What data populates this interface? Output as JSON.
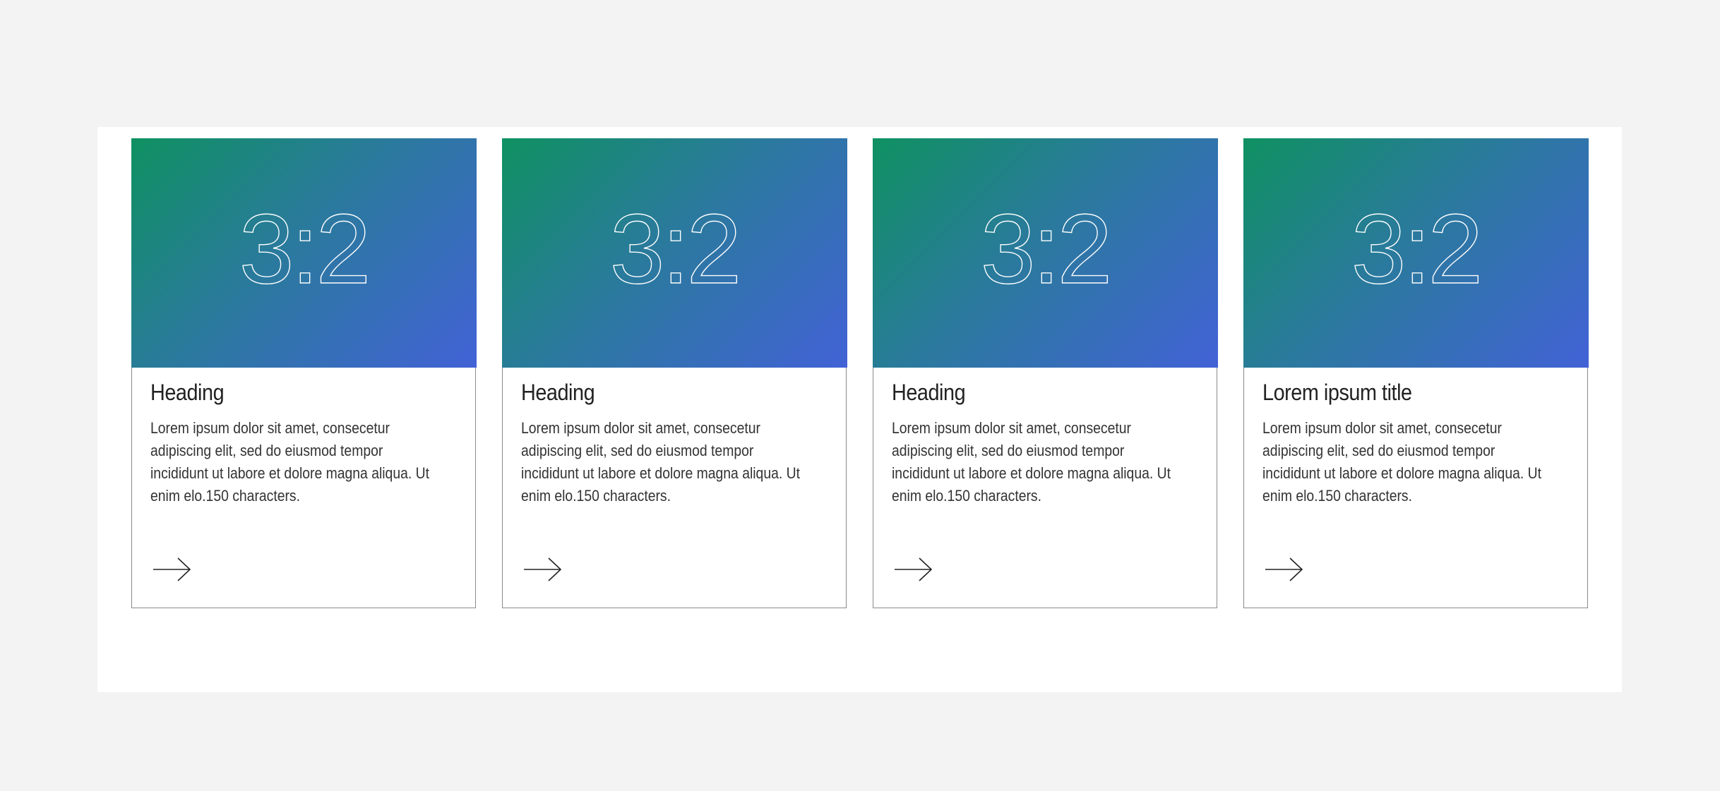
{
  "colors": {
    "gradient_start": "#0f9161",
    "gradient_end": "#4262d6"
  },
  "cards": [
    {
      "ratio_label": "3:2",
      "heading": "Heading",
      "body": "Lorem ipsum dolor sit amet, consecetur adipiscing elit, sed do eiusmod tempor incididunt ut labore et dolore magna aliqua. Ut enim elo.150 characters.",
      "icon": "arrow-right-icon"
    },
    {
      "ratio_label": "3:2",
      "heading": "Heading",
      "body": "Lorem ipsum dolor sit amet, consecetur adipiscing elit, sed do eiusmod tempor incididunt ut labore et dolore magna aliqua. Ut enim elo.150 characters.",
      "icon": "arrow-right-icon"
    },
    {
      "ratio_label": "3:2",
      "heading": "Heading",
      "body": "Lorem ipsum dolor sit amet, consecetur adipiscing elit, sed do eiusmod tempor incididunt ut labore et dolore magna aliqua. Ut enim elo.150 characters.",
      "icon": "arrow-right-icon"
    },
    {
      "ratio_label": "3:2",
      "heading": "Lorem ipsum title",
      "body": "Lorem ipsum dolor sit amet, consecetur adipiscing elit, sed do eiusmod tempor incididunt ut labore et dolore magna aliqua. Ut enim elo.150 characters.",
      "icon": "arrow-right-icon"
    }
  ]
}
